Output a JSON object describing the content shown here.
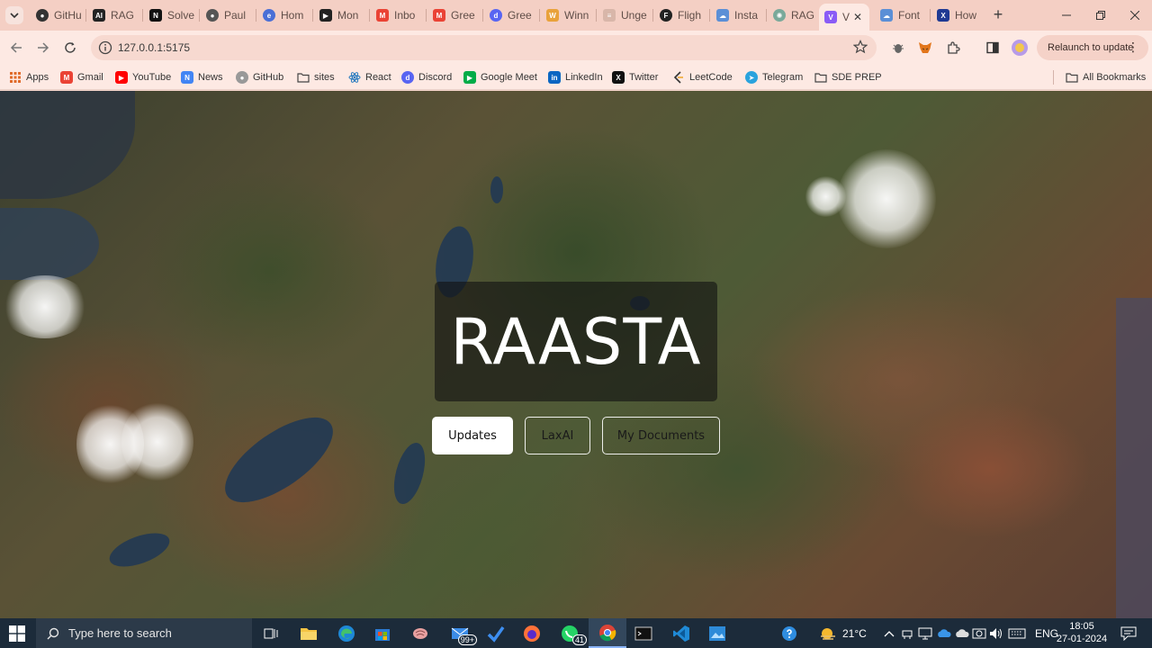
{
  "browser": {
    "tabs": [
      {
        "label": "GitHu",
        "icon": "github-icon"
      },
      {
        "label": "RAG",
        "icon": "ai-icon"
      },
      {
        "label": "Solve",
        "icon": "nm-icon"
      },
      {
        "label": "Paul",
        "icon": "github-icon"
      },
      {
        "label": "Hom",
        "icon": "edge-icon"
      },
      {
        "label": "Mon",
        "icon": "flag-icon"
      },
      {
        "label": "Inbo",
        "icon": "gmail-icon"
      },
      {
        "label": "Gree",
        "icon": "gmail-icon"
      },
      {
        "label": "Gree",
        "icon": "discord-icon"
      },
      {
        "label": "Winn",
        "icon": "w-icon"
      },
      {
        "label": "Unge",
        "icon": "tabs-icon"
      },
      {
        "label": "Fligh",
        "icon": "f-icon"
      },
      {
        "label": "Insta",
        "icon": "cloud-icon"
      },
      {
        "label": "RAG",
        "icon": "openai-icon"
      },
      {
        "label": "V",
        "icon": "vite-icon",
        "active": true
      },
      {
        "label": "Font",
        "icon": "cloud-icon"
      },
      {
        "label": "How",
        "icon": "x-icon"
      }
    ],
    "address": "127.0.0.1:5175",
    "relaunch_label": "Relaunch to update",
    "bookmarks": [
      {
        "label": "Apps"
      },
      {
        "label": "Gmail"
      },
      {
        "label": "YouTube"
      },
      {
        "label": "News"
      },
      {
        "label": "GitHub"
      },
      {
        "label": "sites"
      },
      {
        "label": "React"
      },
      {
        "label": "Discord"
      },
      {
        "label": "Google Meet"
      },
      {
        "label": "LinkedIn"
      },
      {
        "label": "Twitter"
      },
      {
        "label": "LeetCode"
      },
      {
        "label": "Telegram"
      },
      {
        "label": "SDE PREP"
      }
    ],
    "all_bookmarks_label": "All Bookmarks"
  },
  "page": {
    "title": "RAASTA",
    "buttons": {
      "updates": "Updates",
      "laxai": "LaxAI",
      "documents": "My Documents"
    }
  },
  "taskbar": {
    "search_placeholder": "Type here to search",
    "mail_badge": "99+",
    "whatsapp_badge": "41",
    "weather": "21°C",
    "language": "ENG",
    "time": "18:05",
    "date": "27-01-2024"
  },
  "colors": {
    "tabstrip": "#f4cfc4",
    "toolbar": "#fde9e3",
    "taskbar": "#1c2b3a"
  }
}
